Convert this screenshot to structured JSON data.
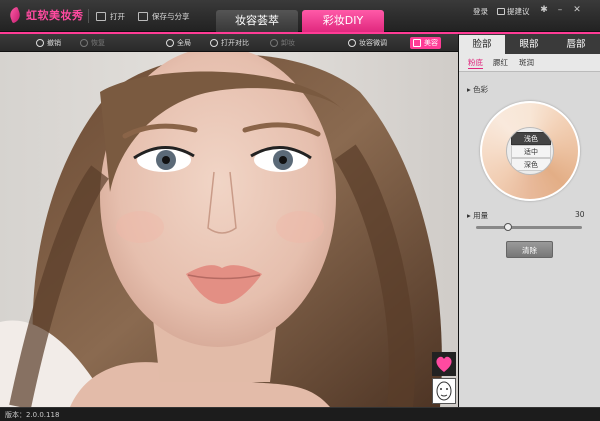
{
  "app": {
    "title": "虹软美妆秀"
  },
  "titlebar": {
    "open": "打开",
    "save_share": "保存与分享",
    "tab_makeup": "妆容荟萃",
    "tab_diy": "彩妆DIY",
    "login": "登录",
    "feedback": "提建议"
  },
  "toolbar": {
    "undo": "撤销",
    "redo": "恢复",
    "full": "全局",
    "compare": "打开对比",
    "erase": "卸妆",
    "adjust": "妆容微调",
    "beauty": "美容"
  },
  "panel": {
    "tabs": [
      "脸部",
      "眼部",
      "唇部"
    ],
    "subtabs": [
      "粉底",
      "腮红",
      "斑润"
    ],
    "color_label": "色彩",
    "options": [
      "浅色",
      "适中",
      "深色"
    ],
    "selected_option": "浅色",
    "amount_label": "用量",
    "amount_value": "30",
    "amount_fraction": 0.3,
    "clear": "清除"
  },
  "status": {
    "version": "版本：2.0.0.118"
  },
  "colors": {
    "accent": "#ff3c96",
    "panel_bg": "#d9d9d9",
    "chrome": "#2a2a2a"
  },
  "icons": [
    "logo-icon",
    "open-folder-icon",
    "share-icon",
    "chat-icon",
    "settings-icon",
    "minimize-icon",
    "close-icon",
    "undo-icon",
    "redo-icon",
    "fullscreen-icon",
    "compare-icon",
    "erase-icon",
    "adjust-icon",
    "beauty-icon",
    "heart-icon",
    "face-icon"
  ]
}
